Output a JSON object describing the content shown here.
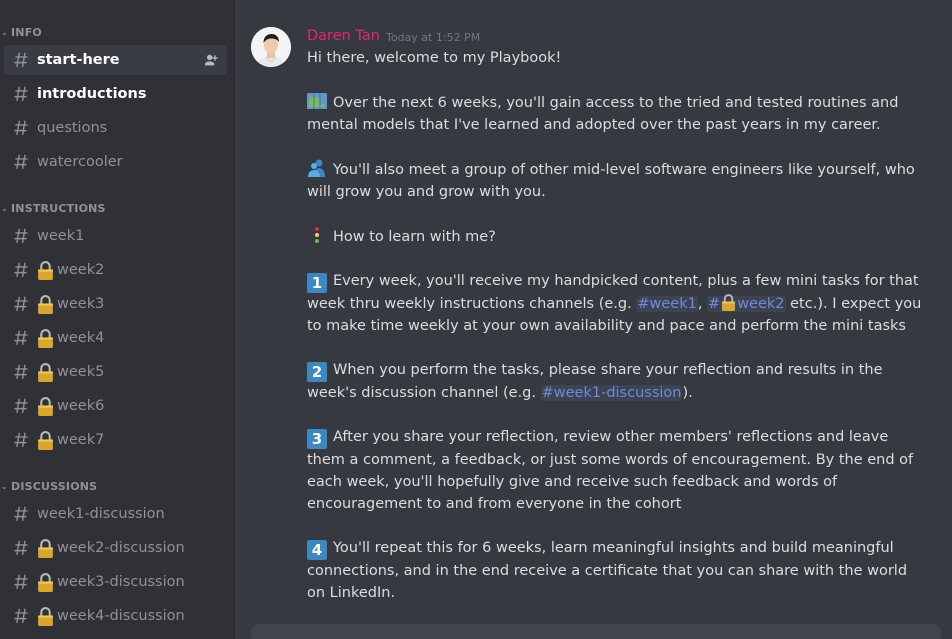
{
  "sidebar": {
    "categories": [
      {
        "label": "INFO"
      },
      {
        "label": "INSTRUCTIONS"
      },
      {
        "label": "DISCUSSIONS"
      }
    ],
    "channels": [
      {
        "name": "start-here"
      },
      {
        "name": "introductions"
      },
      {
        "name": "questions"
      },
      {
        "name": "watercooler"
      },
      {
        "name": "week1"
      },
      {
        "name": "week2"
      },
      {
        "name": "week3"
      },
      {
        "name": "week4"
      },
      {
        "name": "week5"
      },
      {
        "name": "week6"
      },
      {
        "name": "week7"
      },
      {
        "name": "week1-discussion"
      },
      {
        "name": "week2-discussion"
      },
      {
        "name": "week3-discussion"
      },
      {
        "name": "week4-discussion"
      }
    ]
  },
  "message": {
    "author": "Daren Tan",
    "author_color": "#e8246d",
    "timestamp": "Today at 1:52 PM",
    "greeting": "Hi there, welcome to my Playbook!",
    "p1": "Over the next 6 weeks, you'll gain access to the tried and tested routines and mental models that I've learned and adopted over the past years in my career.",
    "p2": "You'll also meet a group of other mid-level software engineers like yourself, who will grow you and grow with you.",
    "p3": "How to learn with me?",
    "p4_num": "1",
    "p4_a": "Every week, you'll receive my handpicked content, plus a few mini tasks for that week thru weekly instructions channels (e.g. ",
    "p4_m1": "#week1",
    "p4_b": ", ",
    "p4_m2_hash": "#",
    "p4_m2_name": "week2",
    "p4_c": " etc.). I expect you to make time weekly at your own availability and pace and perform the mini tasks",
    "p5_num": "2",
    "p5_a": "When you perform the tasks, please share your reflection and results in the week's discussion channel (e.g. ",
    "p5_m1": "#week1-discussion",
    "p5_b": ").",
    "p6_num": "3",
    "p6": "After you share your reflection, review other members' reflections and leave them a comment, a feedback, or just some words of encouragement. By the end of each week, you'll hopefully give and receive such feedback and words of encouragement to and from everyone in the cohort",
    "p7_num": "4",
    "p7": "You'll repeat this for 6 weeks, learn meaningful insights and build meaningful connections, and in the end receive a certificate that you can share with the world on LinkedIn."
  },
  "colors": {
    "sidebar_bg": "#2f3136",
    "chat_bg": "#36393f",
    "mention": "#7289da",
    "number_badge": "#3b88c3"
  },
  "icons": [
    "hashtag-icon",
    "lock-icon",
    "add-member-icon",
    "map-emoji",
    "people-emoji",
    "traffic-light-emoji"
  ]
}
